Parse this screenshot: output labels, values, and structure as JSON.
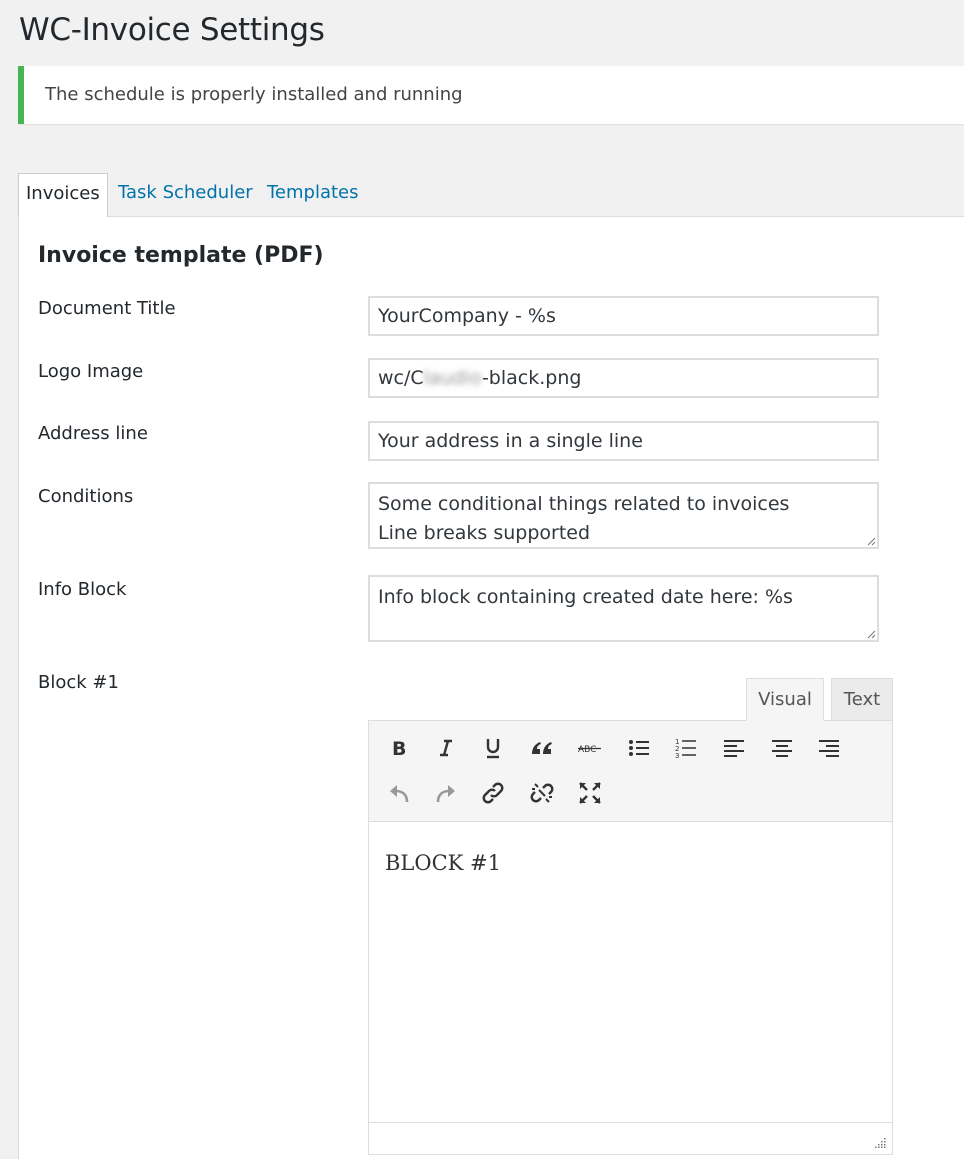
{
  "page": {
    "title": "WC-Invoice Settings"
  },
  "notice": {
    "text": "The schedule is properly installed and running",
    "color": "#46b450"
  },
  "tabs": [
    {
      "label": "Invoices",
      "active": true
    },
    {
      "label": "Task Scheduler",
      "active": false
    },
    {
      "label": "Templates",
      "active": false
    }
  ],
  "section": {
    "title": "Invoice template (PDF)"
  },
  "fields": {
    "document_title": {
      "label": "Document Title",
      "value": "YourCompany - %s"
    },
    "logo_image": {
      "label": "Logo Image",
      "value_prefix": "wc/C",
      "value_suffix": "-black.png"
    },
    "address_line": {
      "label": "Address line",
      "value": "Your address in a single line"
    },
    "conditions": {
      "label": "Conditions",
      "value": "Some conditional things related to invoices\nLine breaks supported"
    },
    "info_block": {
      "label": "Info Block",
      "value": "Info block containing created date here: %s"
    },
    "block1": {
      "label": "Block #1"
    }
  },
  "editor": {
    "tabs": {
      "visual": "Visual",
      "text": "Text"
    },
    "content": "BLOCK #1",
    "toolbar_icons": [
      "bold-icon",
      "italic-icon",
      "underline-icon",
      "blockquote-icon",
      "strikethrough-icon",
      "bullet-list-icon",
      "numbered-list-icon",
      "align-left-icon",
      "align-center-icon",
      "align-right-icon",
      "undo-icon",
      "redo-icon",
      "link-icon",
      "unlink-icon",
      "fullscreen-icon"
    ]
  },
  "colors": {
    "link": "#0073aa",
    "text": "#23282d",
    "background": "#f1f1f1"
  }
}
